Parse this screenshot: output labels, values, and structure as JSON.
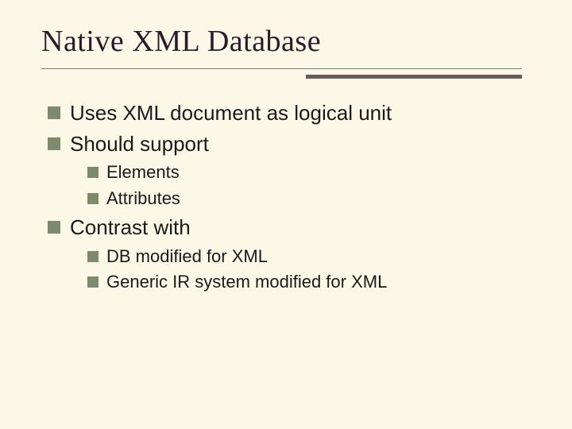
{
  "title": "Native XML Database",
  "bullets": [
    {
      "level": 1,
      "text": "Uses XML document as logical unit"
    },
    {
      "level": 1,
      "text": "Should support"
    },
    {
      "level": 2,
      "text": "Elements"
    },
    {
      "level": 2,
      "text": "Attributes"
    },
    {
      "level": 1,
      "text": "Contrast with"
    },
    {
      "level": 2,
      "text": "DB modified for XML"
    },
    {
      "level": 2,
      "text": "Generic IR system modified for XML"
    }
  ]
}
